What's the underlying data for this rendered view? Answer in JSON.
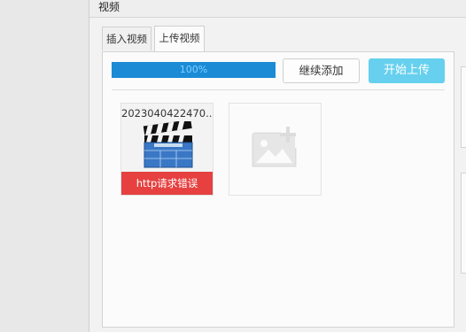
{
  "window": {
    "title": "视频"
  },
  "tabs": [
    {
      "label": "插入视频"
    },
    {
      "label": "上传视频"
    }
  ],
  "upload": {
    "progress_label": "100%",
    "progress_value": 100,
    "continue_button": "继续添加",
    "start_button": "开始上传"
  },
  "files": [
    {
      "name": "2023040422470...",
      "status": "http请求错误",
      "icon": "clapperboard-icon"
    }
  ],
  "add_slot": {
    "icon": "add-image-icon"
  },
  "colors": {
    "progress": "#1b8bd6",
    "start_button": "#66d0ee",
    "error": "#e64040"
  }
}
